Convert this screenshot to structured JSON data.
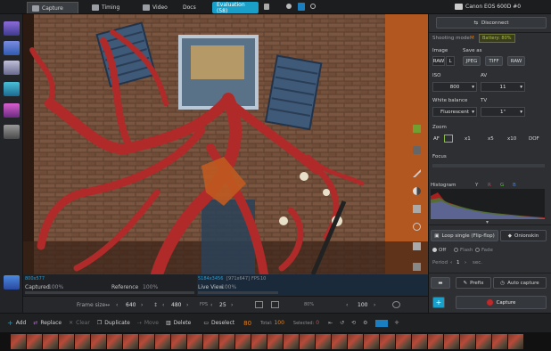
{
  "tabs": [
    {
      "label": "Capture"
    },
    {
      "label": "Timing"
    },
    {
      "label": "Video"
    },
    {
      "label": "Docs"
    },
    {
      "label": "Evaluation (58)"
    }
  ],
  "camera": {
    "name": "Canon EOS 600D #0"
  },
  "panel": {
    "disconnect": "Disconnect",
    "shooting_mode_label": "Shooting mode",
    "shooting_mode_value": "M",
    "battery": "Battery: 80%",
    "image_label": "Image",
    "image_value": "RAW",
    "image_value2": "L",
    "save_as_label": "Save as",
    "save_jpeg": "JPEG",
    "save_tiff": "TIFF",
    "save_raw": "RAW",
    "iso_label": "ISO",
    "iso_value": "800",
    "av_label": "AV",
    "av_value": "11",
    "wb_label": "White balance",
    "wb_value": "Fluorescent",
    "tv_label": "TV",
    "tv_value": "1\"",
    "zoom_label": "Zoom",
    "zoom_af": "AF",
    "zoom_x1": "x1",
    "zoom_x5": "x5",
    "zoom_x10": "x10",
    "zoom_dof": "DOF",
    "focus_label": "Focus",
    "histogram_label": "Histogram",
    "hist_y": "Y",
    "hist_r": "R",
    "hist_g": "G",
    "hist_b": "B",
    "loop_label": "Loop single (Flip-flop)",
    "onionskin": "Onionskin",
    "off": "Off",
    "flash": "Flash",
    "fade": "Fade",
    "period_label": "Period",
    "period_value": "1",
    "period_unit": "sec.",
    "prefix": "Prefix",
    "auto_capture": "Auto capture",
    "capture": "Capture"
  },
  "info": {
    "captured_dims": "800x577",
    "captured_label": "Captured",
    "captured_pct": "100%",
    "reference_label": "Reference",
    "reference_pct": "100%",
    "live_dims": "5184x3456",
    "live_extra": "[971x647]",
    "fps_label": "FPS",
    "fps_value": "10",
    "live_label": "Live View",
    "live_pct": "100%"
  },
  "framerow": {
    "label": "Frame size",
    "width": "640",
    "height": "480",
    "fps_label": "FPS",
    "fps_value": "25",
    "zoom": "100",
    "pct": "80%"
  },
  "actions": {
    "add": "Add",
    "replace": "Replace",
    "clear": "Clear",
    "duplicate": "Duplicate",
    "move": "Move",
    "delete": "Delete",
    "deselect": "Deselect",
    "frame": "80",
    "total_label": "Total:",
    "total": "100",
    "selected_label": "Selected:",
    "selected": "0"
  },
  "colors": {
    "accent": "#1aa0c8",
    "capture_red": "#c0282a",
    "view_bg": "#3a2a1f"
  }
}
